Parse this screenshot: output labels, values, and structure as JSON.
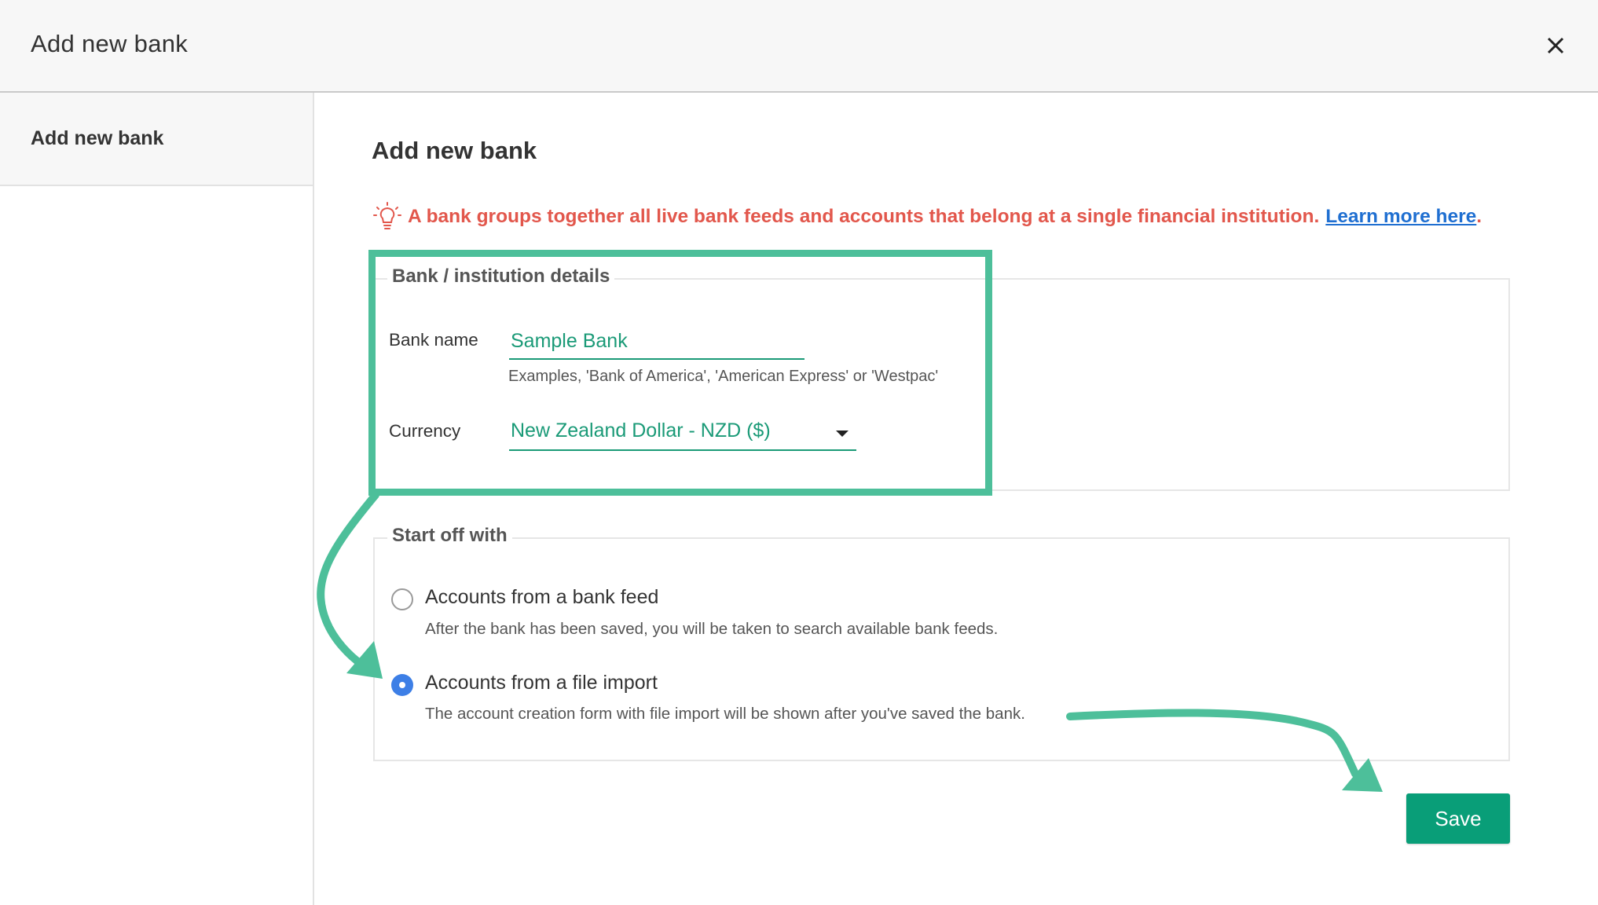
{
  "header": {
    "title": "Add new bank",
    "close_icon": "close-icon"
  },
  "sidebar": {
    "items": [
      {
        "label": "Add new bank",
        "active": true
      }
    ]
  },
  "main": {
    "title": "Add new bank",
    "info": {
      "icon": "lightbulb-icon",
      "text": "A bank groups together all live bank feeds and accounts that belong at a single financial institution.",
      "link_text": "Learn more here",
      "trailing": ".",
      "color": "#e2574c",
      "link_color": "#1f6fd1"
    },
    "bank_details": {
      "legend": "Bank / institution details",
      "bank_name_label": "Bank name",
      "bank_name_value": "Sample Bank",
      "bank_name_hint": "Examples, 'Bank of America', 'American Express' or 'Westpac'",
      "currency_label": "Currency",
      "currency_value": "New Zealand Dollar - NZD ($)"
    },
    "start_off": {
      "legend": "Start off with",
      "options": [
        {
          "label": "Accounts from a bank feed",
          "description": "After the bank has been saved, you will be taken to search available bank feeds.",
          "checked": false
        },
        {
          "label": "Accounts from a file import",
          "description": "The account creation form with file import will be shown after you've saved the bank.",
          "checked": true
        }
      ]
    },
    "save_label": "Save"
  },
  "colors": {
    "accent": "#1a9a77",
    "save_button": "#099e78",
    "annotation": "#4dbf9a",
    "radio_checked": "#3d7fe6"
  }
}
